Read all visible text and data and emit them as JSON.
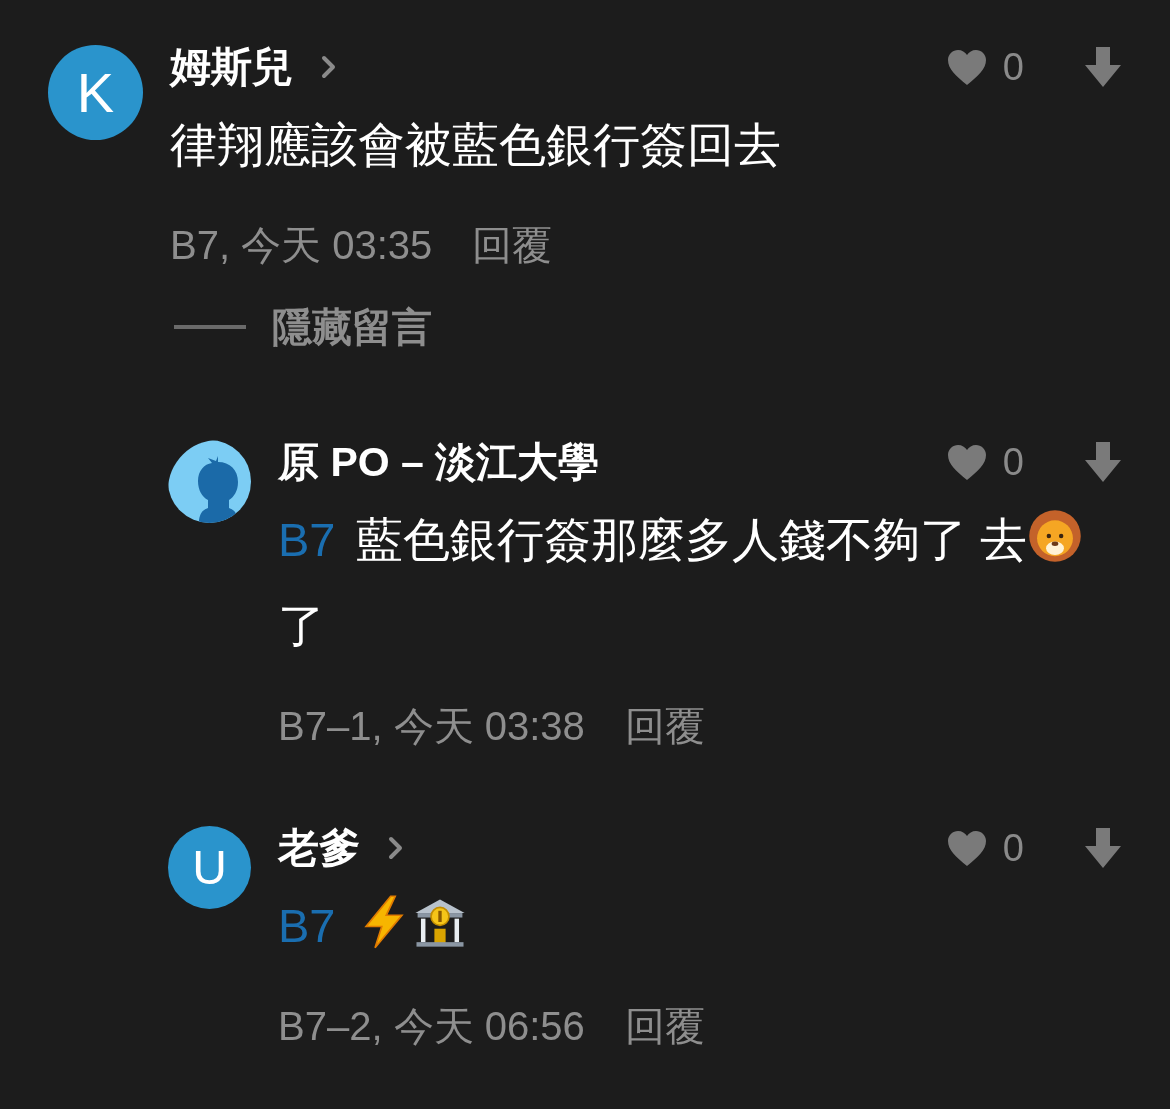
{
  "comments": [
    {
      "avatar": {
        "kind": "letter",
        "letter": "K",
        "color": "#2a94cc"
      },
      "name": "姆斯兒",
      "profile_link": true,
      "likes": "0",
      "body": [
        {
          "kind": "text",
          "text": "律翔應該會被藍色銀行簽回去"
        }
      ],
      "meta": "B7, 今天 03:35",
      "reply": "回覆",
      "collapse_label": "隱藏留言",
      "replies": [
        {
          "avatar": {
            "kind": "silhouette"
          },
          "name": "原 PO – 淡江大學",
          "profile_link": false,
          "likes": "0",
          "body": [
            {
              "kind": "mention",
              "text": "B7"
            },
            {
              "kind": "text",
              "text": "藍色銀行簽那麼多人錢不夠了 去"
            },
            {
              "kind": "lion-emoji"
            },
            {
              "kind": "text",
              "text": "了"
            }
          ],
          "meta": "B7–1, 今天 03:38",
          "reply": "回覆"
        },
        {
          "avatar": {
            "kind": "letter",
            "letter": "U",
            "color": "#2a94cc"
          },
          "name": "老爹",
          "profile_link": true,
          "likes": "0",
          "body": [
            {
              "kind": "mention",
              "text": "B7"
            },
            {
              "kind": "lightning-emoji"
            },
            {
              "kind": "bank-emoji"
            }
          ],
          "meta": "B7–2, 今天 06:56",
          "reply": "回覆"
        }
      ]
    }
  ]
}
